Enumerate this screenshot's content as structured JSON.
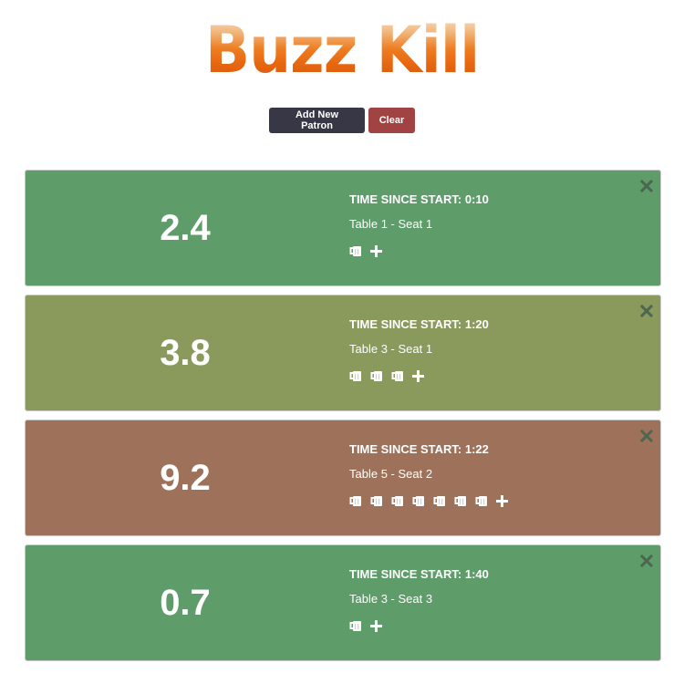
{
  "app": {
    "logo_text": "Buzz Kill"
  },
  "toolbar": {
    "add_label": "Add New Patron",
    "clear_label": "Clear"
  },
  "colors": {
    "safe": "#5e9c6a",
    "caution": "#8a9a5c",
    "danger": "#9e725a",
    "close": "#4c6650",
    "add_button": "#373745",
    "clear_button": "#a14343"
  },
  "icons": {
    "drink": "beer-mug-icon",
    "add": "plus-icon",
    "remove": "close-icon"
  },
  "patrons": [
    {
      "bac": "2.4",
      "time": "TIME SINCE START: 0:10",
      "seat": "Table 1 - Seat 1",
      "drinks": 1,
      "status": "safe"
    },
    {
      "bac": "3.8",
      "time": "TIME SINCE START: 1:20",
      "seat": "Table 3 - Seat 1",
      "drinks": 3,
      "status": "caution"
    },
    {
      "bac": "9.2",
      "time": "TIME SINCE START: 1:22",
      "seat": "Table 5 - Seat 2",
      "drinks": 7,
      "status": "danger"
    },
    {
      "bac": "0.7",
      "time": "TIME SINCE START: 1:40",
      "seat": "Table 3 - Seat 3",
      "drinks": 1,
      "status": "safe"
    }
  ]
}
